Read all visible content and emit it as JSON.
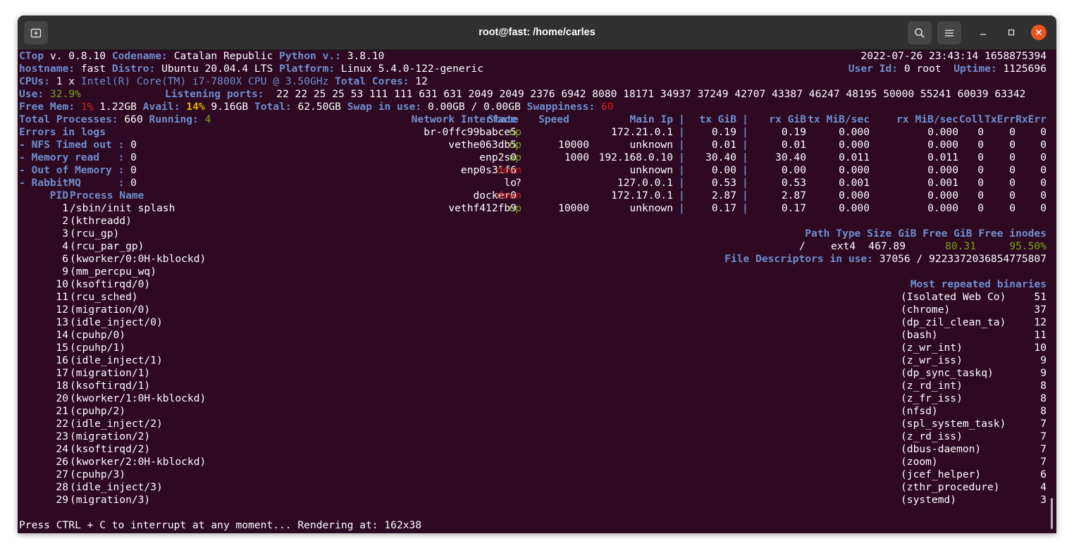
{
  "window": {
    "title": "root@fast: /home/carles",
    "new_tab_icon": "new-tab-icon",
    "search_icon": "search-icon",
    "menu_icon": "hamburger-menu-icon",
    "minimize_icon": "minimize-icon",
    "maximize_icon": "maximize-icon",
    "close_icon": "close-icon",
    "close_color": "#e95420",
    "terminal_bg": "#2d0922"
  },
  "header": {
    "ctop_label": "CTop",
    "ctop_version": " v. 0.8.10",
    "codename_label": "Codename:",
    "codename": " Catalan Republic",
    "python_label": "Python v.:",
    "python_version": " 3.8.10",
    "datetime": "2022-07-26 23:43:14 1658875394",
    "hostname_label": "hostname:",
    "hostname": " fast",
    "distro_label": "Distro:",
    "distro": " Ubuntu 20.04.4 LTS",
    "platform_label": "Platform:",
    "platform": " Linux 5.4.0-122-generic",
    "userid_label": "User Id:",
    "userid": " 0 root",
    "uptime_label": "Uptime:",
    "uptime": " 1125696",
    "cpus_label": "CPUs:",
    "cpus_count": " 1 x ",
    "cpu_model": "Intel(R) Core(TM) i7-7800X CPU @ 3.50GHz",
    "total_cores_label": "Total Cores:",
    "total_cores": " 12",
    "use_label": "Use:",
    "use_value": "32.9%",
    "listening_label": "Listening ports:",
    "listening_ports": "22 22 25 25 53 111 111 631 631 2049 2049 2376 6942 8080 18171 34937 37249 42707 43387 46247 48195 50000 55241 60039 63342",
    "freemem_label": "Free Mem:",
    "freemem_pct": "1%",
    "freemem_val": " 1.22GB",
    "avail_label": "Avail:",
    "avail_pct": "14%",
    "avail_val": " 9.16GB",
    "total_label": "Total:",
    "total_val": " 62.50GB",
    "swap_label": "Swap in use:",
    "swap_val": " 0.00GB / 0.00GB",
    "swappiness_label": "Swappiness:",
    "swappiness_val": "60",
    "total_proc_label": "Total Processes:",
    "total_proc": " 660",
    "running_label": "Running:",
    "running": "4"
  },
  "errors": {
    "title": "Errors in logs",
    "items": [
      {
        "label": "- NFS Timed out :",
        "value": " 0"
      },
      {
        "label": "- Memory read   :",
        "value": " 0"
      },
      {
        "label": "- Out of Memory :",
        "value": " 0"
      },
      {
        "label": "- RabbitMQ      :",
        "value": " 0"
      }
    ]
  },
  "network": {
    "headers": {
      "iface": "Network Interface",
      "state": "State",
      "speed": "Speed",
      "ip": "Main Ip",
      "sep1": "|",
      "tx": "tx GiB",
      "sep2": "|",
      "rx": "rx GiB",
      "txs": "tx MiB/sec",
      "rxs": "rx MiB/sec",
      "coll": "Coll",
      "txerr": "TxErr",
      "rxerr": "RxErr"
    },
    "rows": [
      {
        "iface": "br-0ffc99babce5",
        "state": "up",
        "speed": "",
        "ip": "172.21.0.1",
        "sep1": "|",
        "tx": "0.19",
        "sep2": "|",
        "rx": "0.19",
        "txs": "0.000",
        "rxs": "0.000",
        "coll": "0",
        "txerr": "0",
        "rxerr": "0"
      },
      {
        "iface": "vethe063db5",
        "state": "up",
        "speed": "10000",
        "ip": "unknown",
        "sep1": "|",
        "tx": "0.01",
        "sep2": "|",
        "rx": "0.01",
        "txs": "0.000",
        "rxs": "0.000",
        "coll": "0",
        "txerr": "0",
        "rxerr": "0"
      },
      {
        "iface": "enp2s0",
        "state": "up",
        "speed": "1000",
        "ip": "192.168.0.10",
        "sep1": "|",
        "tx": "30.40",
        "sep2": "|",
        "rx": "30.40",
        "txs": "0.011",
        "rxs": "0.011",
        "coll": "0",
        "txerr": "0",
        "rxerr": "0"
      },
      {
        "iface": "enp0s31f6",
        "state": "down",
        "speed": "",
        "ip": "unknown",
        "sep1": "|",
        "tx": "0.00",
        "sep2": "|",
        "rx": "0.00",
        "txs": "0.000",
        "rxs": "0.000",
        "coll": "0",
        "txerr": "0",
        "rxerr": "0"
      },
      {
        "iface": "lo",
        "state": "?",
        "speed": "",
        "ip": "127.0.0.1",
        "sep1": "|",
        "tx": "0.53",
        "sep2": "|",
        "rx": "0.53",
        "txs": "0.001",
        "rxs": "0.001",
        "coll": "0",
        "txerr": "0",
        "rxerr": "0"
      },
      {
        "iface": "docker0",
        "state": "down",
        "speed": "",
        "ip": "172.17.0.1",
        "sep1": "|",
        "tx": "2.87",
        "sep2": "|",
        "rx": "2.87",
        "txs": "0.000",
        "rxs": "0.000",
        "coll": "0",
        "txerr": "0",
        "rxerr": "0"
      },
      {
        "iface": "vethf412fb9",
        "state": "up",
        "speed": "10000",
        "ip": "unknown",
        "sep1": "|",
        "tx": "0.17",
        "sep2": "|",
        "rx": "0.17",
        "txs": "0.000",
        "rxs": "0.000",
        "coll": "0",
        "txerr": "0",
        "rxerr": "0"
      }
    ]
  },
  "disk": {
    "headers": {
      "path": "Path",
      "type": "Type",
      "size": "Size GiB",
      "free": "Free GiB",
      "inodes": "Free inodes"
    },
    "row": {
      "path": "/",
      "type": "ext4",
      "size": "467.89",
      "free": "80.31",
      "inodes": "95.50%"
    },
    "fd_label": "File Descriptors in use:",
    "fd_value": " 37056 / 9223372036854775807"
  },
  "processes": {
    "pid_header": "PID",
    "name_header": "Process Name",
    "rows": [
      {
        "pid": "1",
        "name": "/sbin/init splash"
      },
      {
        "pid": "2",
        "name": "(kthreadd)"
      },
      {
        "pid": "3",
        "name": "(rcu_gp)"
      },
      {
        "pid": "4",
        "name": "(rcu_par_gp)"
      },
      {
        "pid": "6",
        "name": "(kworker/0:0H-kblockd)"
      },
      {
        "pid": "9",
        "name": "(mm_percpu_wq)"
      },
      {
        "pid": "10",
        "name": "(ksoftirqd/0)"
      },
      {
        "pid": "11",
        "name": "(rcu_sched)"
      },
      {
        "pid": "12",
        "name": "(migration/0)"
      },
      {
        "pid": "13",
        "name": "(idle_inject/0)"
      },
      {
        "pid": "14",
        "name": "(cpuhp/0)"
      },
      {
        "pid": "15",
        "name": "(cpuhp/1)"
      },
      {
        "pid": "16",
        "name": "(idle_inject/1)"
      },
      {
        "pid": "17",
        "name": "(migration/1)"
      },
      {
        "pid": "18",
        "name": "(ksoftirqd/1)"
      },
      {
        "pid": "20",
        "name": "(kworker/1:0H-kblockd)"
      },
      {
        "pid": "21",
        "name": "(cpuhp/2)"
      },
      {
        "pid": "22",
        "name": "(idle_inject/2)"
      },
      {
        "pid": "23",
        "name": "(migration/2)"
      },
      {
        "pid": "24",
        "name": "(ksoftirqd/2)"
      },
      {
        "pid": "26",
        "name": "(kworker/2:0H-kblockd)"
      },
      {
        "pid": "27",
        "name": "(cpuhp/3)"
      },
      {
        "pid": "28",
        "name": "(idle_inject/3)"
      },
      {
        "pid": "29",
        "name": "(migration/3)"
      }
    ]
  },
  "binaries": {
    "title": "Most repeated binaries",
    "rows": [
      {
        "name": "(Isolated Web Co)",
        "count": "51"
      },
      {
        "name": "(chrome)",
        "count": "37"
      },
      {
        "name": "(dp_zil_clean_ta)",
        "count": "12"
      },
      {
        "name": "(bash)",
        "count": "11"
      },
      {
        "name": "(z_wr_int)",
        "count": "10"
      },
      {
        "name": "(z_wr_iss)",
        "count": "9"
      },
      {
        "name": "(dp_sync_taskq)",
        "count": "9"
      },
      {
        "name": "(z_rd_int)",
        "count": "8"
      },
      {
        "name": "(z_fr_iss)",
        "count": "8"
      },
      {
        "name": "(nfsd)",
        "count": "8"
      },
      {
        "name": "(spl_system_task)",
        "count": "7"
      },
      {
        "name": "(z_rd_iss)",
        "count": "7"
      },
      {
        "name": "(dbus-daemon)",
        "count": "7"
      },
      {
        "name": "(zoom)",
        "count": "7"
      },
      {
        "name": "(jcef_helper)",
        "count": "6"
      },
      {
        "name": "(zthr_procedure)",
        "count": "4"
      },
      {
        "name": "(systemd)",
        "count": "3"
      }
    ]
  },
  "footer": {
    "text": "Press CTRL + C to interrupt at any moment... Rendering at: 162x38"
  }
}
